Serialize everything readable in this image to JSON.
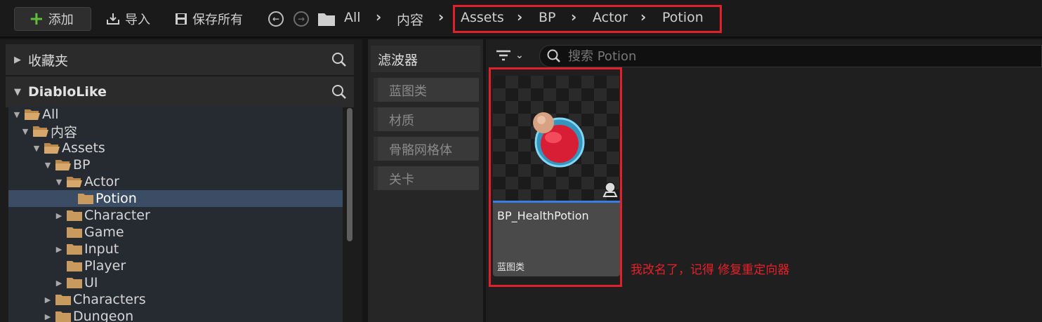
{
  "toolbar": {
    "add_label": "添加",
    "import_label": "导入",
    "save_all_label": "保存所有"
  },
  "breadcrumb": [
    "All",
    "内容",
    "Assets",
    "BP",
    "Actor",
    "Potion"
  ],
  "left_panel": {
    "favorites_label": "收藏夹",
    "project_label": "DiabloLike",
    "tree": [
      {
        "label": "All",
        "expanded": true
      },
      {
        "label": "内容",
        "expanded": true
      },
      {
        "label": "Assets",
        "expanded": true
      },
      {
        "label": "BP",
        "expanded": true
      },
      {
        "label": "Actor",
        "expanded": true
      },
      {
        "label": "Potion",
        "selected": true
      },
      {
        "label": "Character",
        "expanded": false
      },
      {
        "label": "Game"
      },
      {
        "label": "Input",
        "expanded": false
      },
      {
        "label": "Player"
      },
      {
        "label": "UI",
        "expanded": false
      },
      {
        "label": "Characters",
        "expanded": false
      },
      {
        "label": "Dungeon",
        "expanded": false
      }
    ]
  },
  "filters": {
    "title": "滤波器",
    "items": [
      "蓝图类",
      "材质",
      "骨骼网格体",
      "关卡"
    ]
  },
  "content": {
    "search_placeholder": "搜索 Potion",
    "asset": {
      "name": "BP_HealthPotion",
      "type": "蓝图类"
    },
    "annotation": "我改名了，记得 修复重定向器"
  },
  "colors": {
    "highlight_red": "#e0202a",
    "selection_blue": "#3a4d64",
    "asset_bar_blue": "#3b7de0",
    "folder": "#c89a5e",
    "add_green": "#5fbf3a"
  }
}
